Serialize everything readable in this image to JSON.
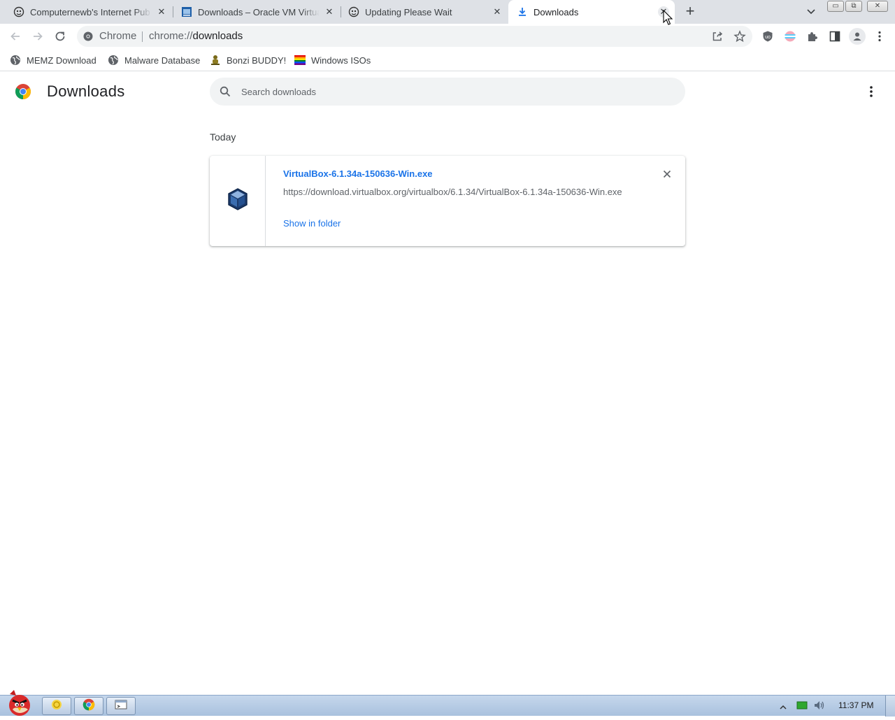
{
  "tabs": [
    {
      "label": "Computernewb's Internet Pub",
      "icon": "computernewb-icon",
      "close": "✕"
    },
    {
      "label": "Downloads – Oracle VM Virtual",
      "icon": "virtualbox-site-icon",
      "close": "✕"
    },
    {
      "label": "Updating Please Wait",
      "icon": "computernewb-icon",
      "close": "✕"
    },
    {
      "label": "Downloads",
      "icon": "download-icon",
      "close": "✕",
      "active": true
    }
  ],
  "new_tab": "+",
  "window_controls": {
    "minimize": "▭",
    "restore": "⧉",
    "close": "✕"
  },
  "omnibox": {
    "chip": "Chrome",
    "scheme": "chrome://",
    "host": "downloads"
  },
  "bookmarks": [
    {
      "label": "MEMZ Download",
      "icon": "globe-icon"
    },
    {
      "label": "Malware Database",
      "icon": "globe-icon"
    },
    {
      "label": "Bonzi BUDDY!",
      "icon": "bonzi-icon"
    },
    {
      "label": "Windows ISOs",
      "icon": "rainbow-flag-icon"
    }
  ],
  "page": {
    "title": "Downloads",
    "search_placeholder": "Search downloads",
    "date_header": "Today",
    "downloads": [
      {
        "file_name": "VirtualBox-6.1.34a-150636-Win.exe",
        "url": "https://download.virtualbox.org/virtualbox/6.1.34/VirtualBox-6.1.34a-150636-Win.exe",
        "action": "Show in folder",
        "icon": "virtualbox-icon"
      }
    ]
  },
  "taskbar": {
    "clock": "11:37 PM",
    "apps": [
      "explorer-icon",
      "chrome-icon",
      "terminal-icon"
    ]
  },
  "colors": {
    "accent": "#1a73e8",
    "tabstrip": "#dee1e6",
    "omnibox_bg": "#f1f3f4"
  }
}
